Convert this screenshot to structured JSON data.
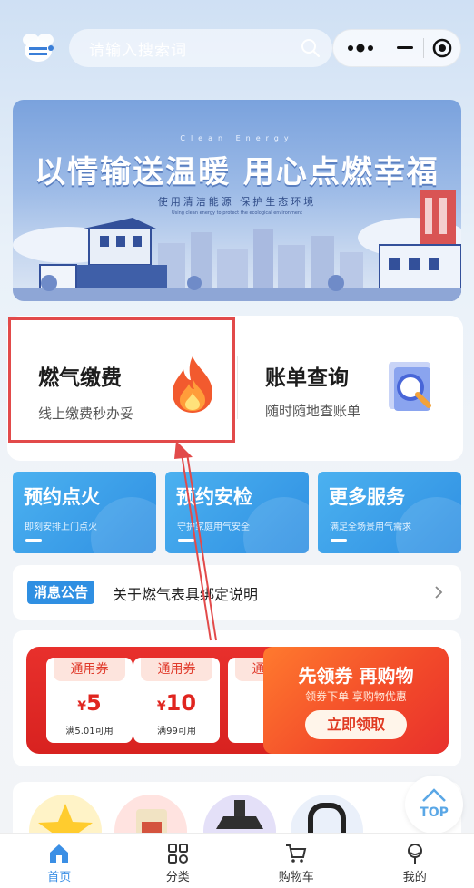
{
  "search": {
    "placeholder": "请输入搜索词"
  },
  "banner": {
    "title": "以情输送温暖 用心点燃幸福",
    "english": "Clean Energy",
    "subtitle": "使用清洁能源 保护生态环境",
    "tiny": "Using clean energy to protect the ecological environment"
  },
  "services_top": {
    "pay": {
      "title": "燃气缴费",
      "desc": "线上缴费秒办妥"
    },
    "bill": {
      "title": "账单查询",
      "desc": "随时随地查账单"
    }
  },
  "tiles": [
    {
      "title": "预约点火",
      "desc": "即刻安排上门点火"
    },
    {
      "title": "预约安检",
      "desc": "守护家庭用气安全"
    },
    {
      "title": "更多服务",
      "desc": "满足全场景用气需求"
    }
  ],
  "notice": {
    "tag": "消息公告",
    "text": "关于燃气表具绑定说明"
  },
  "coupons": [
    {
      "label": "通用券",
      "symbol": "¥",
      "amount": "5",
      "condition": "满5.01可用"
    },
    {
      "label": "通用券",
      "symbol": "¥",
      "amount": "10",
      "condition": "满99可用"
    },
    {
      "label": "通用券",
      "symbol": "¥",
      "amount": "",
      "condition": ""
    }
  ],
  "coupon_promo": {
    "headline": "先领券 再购物",
    "sub": "领券下单 享购物优惠",
    "button": "立即领取"
  },
  "top_button": "TOP",
  "tabbar": [
    {
      "label": "首页",
      "icon": "home-icon",
      "active": true
    },
    {
      "label": "分类",
      "icon": "grid-icon",
      "active": false
    },
    {
      "label": "购物车",
      "icon": "cart-icon",
      "active": false
    },
    {
      "label": "我的",
      "icon": "user-icon",
      "active": false
    }
  ],
  "colors": {
    "accent": "#3b8fe5",
    "highlight_box": "#e24a4a",
    "coupon_red": "#e0251f"
  }
}
